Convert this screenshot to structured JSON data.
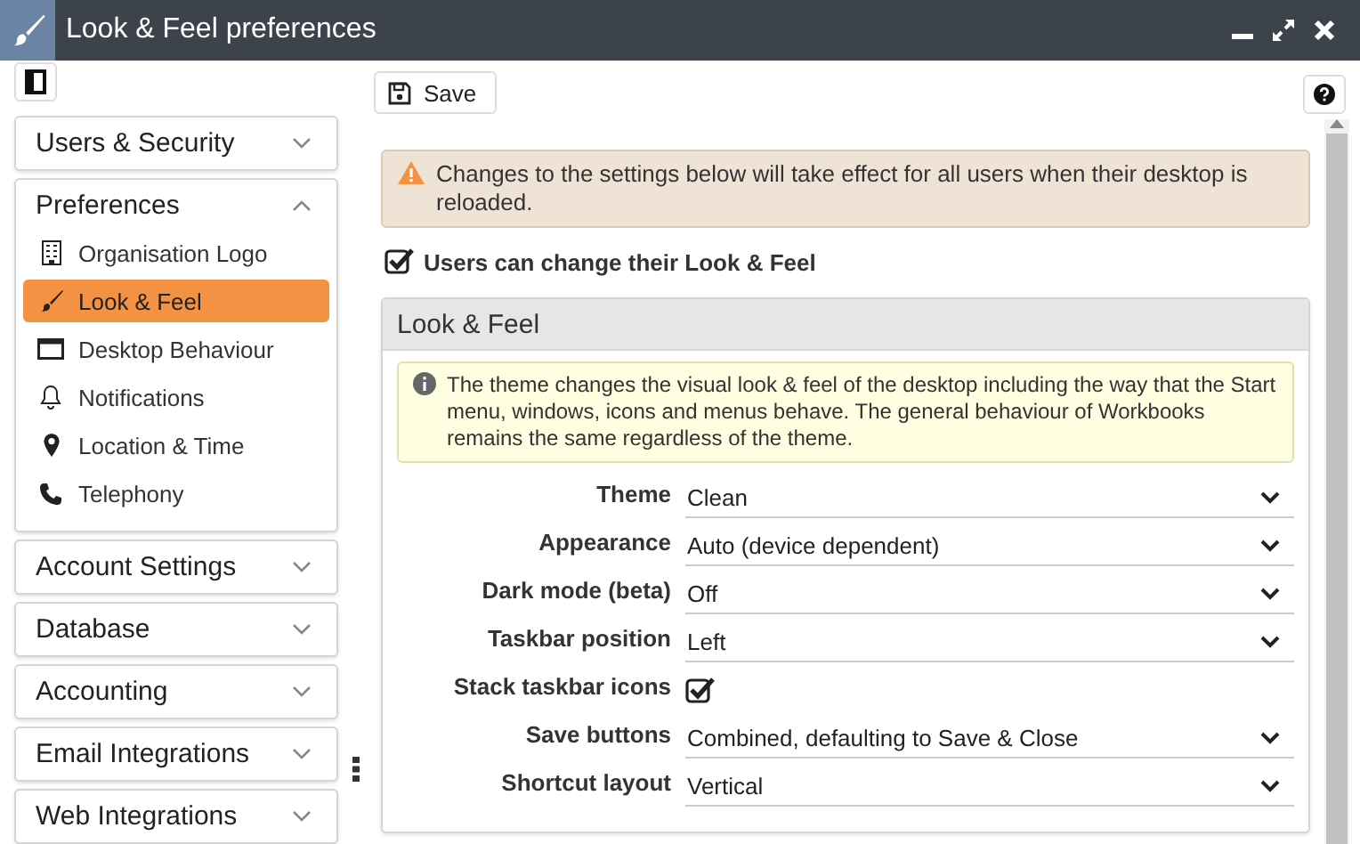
{
  "window": {
    "title": "Look & Feel preferences"
  },
  "toolbar": {
    "save_button": "Save"
  },
  "sidebar": {
    "groups": [
      {
        "label": "Users & Security",
        "expanded": false
      },
      {
        "label": "Preferences",
        "expanded": true,
        "items": [
          {
            "label": "Organisation Logo",
            "selected": false
          },
          {
            "label": "Look & Feel",
            "selected": true
          },
          {
            "label": "Desktop Behaviour",
            "selected": false
          },
          {
            "label": "Notifications",
            "selected": false
          },
          {
            "label": "Location & Time",
            "selected": false
          },
          {
            "label": "Telephony",
            "selected": false
          }
        ]
      },
      {
        "label": "Account Settings",
        "expanded": false
      },
      {
        "label": "Database",
        "expanded": false
      },
      {
        "label": "Accounting",
        "expanded": false
      },
      {
        "label": "Email Integrations",
        "expanded": false
      },
      {
        "label": "Web Integrations",
        "expanded": false
      }
    ]
  },
  "content": {
    "warning": "Changes to the settings below will take effect for all users when their desktop is reloaded.",
    "allow_user_change": {
      "label": "Users can change their Look & Feel",
      "checked": true
    },
    "panel": {
      "title": "Look & Feel",
      "info": "The theme changes the visual look & feel of the desktop including the way that the Start menu, windows, icons and menus behave. The general behaviour of Workbooks remains the same regardless of the theme.",
      "fields": [
        {
          "kind": "select",
          "label": "Theme",
          "value": "Clean"
        },
        {
          "kind": "select",
          "label": "Appearance",
          "value": "Auto (device dependent)"
        },
        {
          "kind": "select",
          "label": "Dark mode (beta)",
          "value": "Off"
        },
        {
          "kind": "select",
          "label": "Taskbar position",
          "value": "Left"
        },
        {
          "kind": "checkbox",
          "label": "Stack taskbar icons",
          "checked": true
        },
        {
          "kind": "select",
          "label": "Save buttons",
          "value": "Combined, defaulting to Save & Close"
        },
        {
          "kind": "select",
          "label": "Shortcut layout",
          "value": "Vertical"
        }
      ]
    }
  }
}
